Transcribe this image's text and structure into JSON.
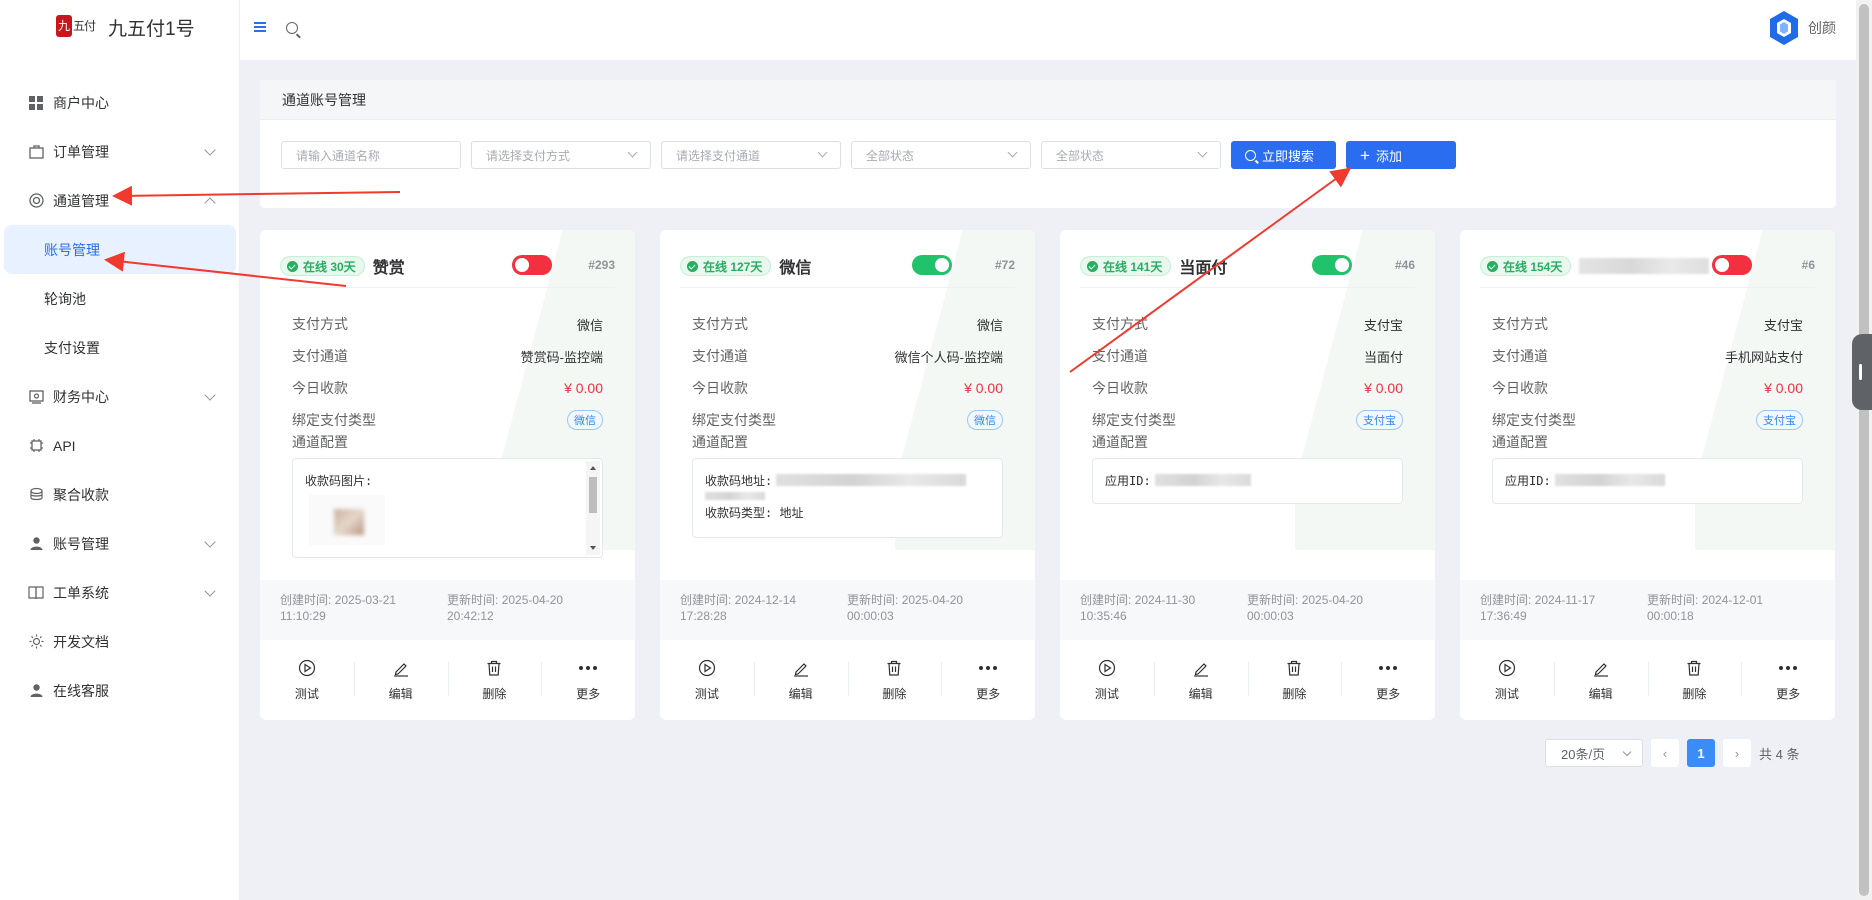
{
  "app": {
    "logo_glyph": "九",
    "logo_glyph2": "五付",
    "title": "九五付1号",
    "user_name": "创颜"
  },
  "sidebar": {
    "items": [
      {
        "label": "商户中心",
        "icon": "grid-icon"
      },
      {
        "label": "订单管理",
        "icon": "bag-icon"
      },
      {
        "label": "通道管理",
        "icon": "channel-icon"
      },
      {
        "label": "账号管理",
        "sub": true,
        "active": true
      },
      {
        "label": "轮询池",
        "sub": true
      },
      {
        "label": "支付设置",
        "sub": true
      },
      {
        "label": "财务中心",
        "icon": "finance-icon"
      },
      {
        "label": "API",
        "icon": "chip-icon"
      },
      {
        "label": "聚合收款",
        "icon": "aggregate-icon"
      },
      {
        "label": "账号管理",
        "icon": "user-icon"
      },
      {
        "label": "工单系统",
        "icon": "book-icon"
      },
      {
        "label": "开发文档",
        "icon": "sun-icon"
      },
      {
        "label": "在线客服",
        "icon": "user-icon"
      }
    ]
  },
  "panel": {
    "title": "通道账号管理",
    "name_placeholder": "请输入通道名称",
    "pay_method": "请选择支付方式",
    "pay_channel": "请选择支付通道",
    "status1": "全部状态",
    "status2": "全部状态",
    "search_label": "立即搜索",
    "add_label": "添加",
    "add_glyph": "+"
  },
  "labels": {
    "pay_method": "支付方式",
    "pay_channel": "支付通道",
    "today": "今日收款",
    "bind_type": "绑定支付类型",
    "config": "通道配置",
    "created": "创建时间:",
    "updated": "更新时间:",
    "act_test": "测试",
    "act_edit": "编辑",
    "act_delete": "删除",
    "act_more": "更多"
  },
  "cards": [
    {
      "online": "在线 30天",
      "title": "赞赏",
      "id": "#293",
      "enabled": false,
      "pay_method": "微信",
      "pay_channel": "赞赏码-监控端",
      "today": "¥ 0.00",
      "bind": "微信",
      "cfg1": "收款码图片:",
      "cfg2": "",
      "created_date": "2025-03-21",
      "created_time": "11:10:29",
      "updated_date": "2025-04-20",
      "updated_time": "20:42:12"
    },
    {
      "online": "在线 127天",
      "title": "微信",
      "id": "#72",
      "enabled": true,
      "pay_method": "微信",
      "pay_channel": "微信个人码-监控端",
      "today": "¥ 0.00",
      "bind": "微信",
      "cfg1": "收款码地址:",
      "cfg2": "收款码类型: 地址",
      "created_date": "2024-12-14",
      "created_time": "17:28:28",
      "updated_date": "2025-04-20",
      "updated_time": "00:00:03"
    },
    {
      "online": "在线 141天",
      "title": "当面付",
      "id": "#46",
      "enabled": true,
      "pay_method": "支付宝",
      "pay_channel": "当面付",
      "today": "¥ 0.00",
      "bind": "支付宝",
      "cfg1": "应用ID:",
      "cfg2": "",
      "created_date": "2024-11-30",
      "created_time": "10:35:46",
      "updated_date": "2025-04-20",
      "updated_time": "00:00:03"
    },
    {
      "online": "在线 154天",
      "title": "",
      "id": "#6",
      "enabled": false,
      "pay_method": "支付宝",
      "pay_channel": "手机网站支付",
      "today": "¥ 0.00",
      "bind": "支付宝",
      "cfg1": "应用ID:",
      "cfg2": "",
      "created_date": "2024-11-17",
      "created_time": "17:36:49",
      "updated_date": "2024-12-01",
      "updated_time": "00:00:18"
    }
  ],
  "pager": {
    "size": "20条/页",
    "current": "1",
    "total": "共 4 条",
    "prev_glyph": "‹",
    "next_glyph": "›"
  },
  "colors": {
    "accent": "#2b6df0",
    "danger": "#f2303f",
    "success": "#22c16b",
    "annotation_arrow": "#f03a2e"
  }
}
